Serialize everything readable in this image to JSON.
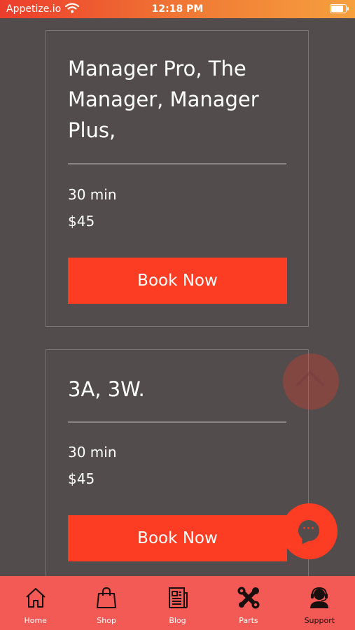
{
  "status_bar": {
    "carrier": "Appetize.io",
    "time": "12:18 PM",
    "battery_level": 0.95
  },
  "services": [
    {
      "title": "Manager Pro, The Manager, Manager Plus,",
      "duration": "30 min",
      "price": "$45",
      "button_label": "Book Now"
    },
    {
      "title": "3A, 3W.",
      "duration": "30 min",
      "price": "$45",
      "button_label": "Book Now"
    }
  ],
  "floating": {
    "scroll_top_icon": "chevron-up-icon",
    "chat_icon": "chat-bubble-icon",
    "chat_dots": "···"
  },
  "nav": {
    "items": [
      {
        "label": "Home",
        "icon": "home-icon"
      },
      {
        "label": "Shop",
        "icon": "shopping-bag-icon"
      },
      {
        "label": "Blog",
        "icon": "newspaper-icon"
      },
      {
        "label": "Parts",
        "icon": "tools-icon"
      },
      {
        "label": "Support",
        "icon": "support-agent-icon"
      }
    ],
    "active_index": 4
  },
  "colors": {
    "background": "#524c4c",
    "accent": "#fc3d24",
    "tabbar": "#f45a55"
  }
}
